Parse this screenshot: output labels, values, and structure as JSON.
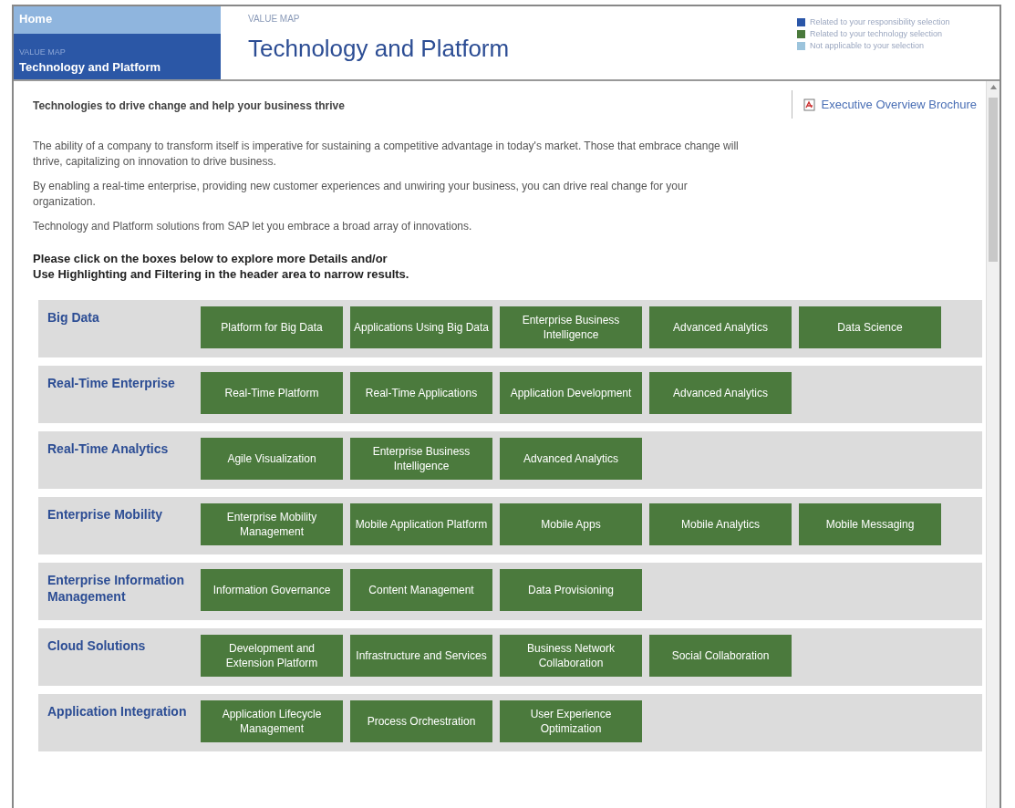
{
  "nav": {
    "home": "Home",
    "section_label": "VALUE MAP",
    "current": "Technology and Platform"
  },
  "header": {
    "eyebrow": "VALUE MAP",
    "title": "Technology and Platform"
  },
  "legend": [
    {
      "label": "Related to your responsibility selection",
      "color": "#2a56a8"
    },
    {
      "label": "Related to your technology selection",
      "color": "#4a7a3c"
    },
    {
      "label": "Not applicable to your selection",
      "color": "#9cc4dc"
    }
  ],
  "brochure_link": "Executive Overview Brochure",
  "heading": "Technologies to drive change and help your business thrive",
  "paragraphs": [
    "The ability of a company to transform itself is imperative for sustaining a competitive advantage in today's market. Those that embrace change will thrive, capitalizing on innovation to drive business.",
    "By enabling a real-time enterprise, providing new customer experiences and unwiring your business, you can drive real change for your organization.",
    "Technology and Platform solutions from SAP let you embrace a broad array of innovations."
  ],
  "instruction_lines": [
    "Please click on the boxes below to explore more Details and/or",
    "Use Highlighting and Filtering in the header area to narrow results."
  ],
  "categories": [
    {
      "name": "Big Data",
      "items": [
        "Platform for Big Data",
        "Applications Using Big Data",
        "Enterprise Business Intelligence",
        "Advanced Analytics",
        "Data Science"
      ]
    },
    {
      "name": "Real-Time Enterprise",
      "items": [
        "Real-Time Platform",
        "Real-Time Applications",
        "Application Development",
        "Advanced Analytics"
      ]
    },
    {
      "name": "Real-Time Analytics",
      "items": [
        "Agile Visualization",
        "Enterprise Business Intelligence",
        "Advanced Analytics"
      ]
    },
    {
      "name": "Enterprise Mobility",
      "items": [
        "Enterprise Mobility Management",
        "Mobile Application Platform",
        "Mobile Apps",
        "Mobile Analytics",
        "Mobile Messaging"
      ]
    },
    {
      "name": "Enterprise Information Management",
      "items": [
        "Information Governance",
        "Content Management",
        "Data Provisioning"
      ]
    },
    {
      "name": "Cloud Solutions",
      "items": [
        "Development and Extension Platform",
        "Infrastructure and Services",
        "Business Network Collaboration",
        "Social Collaboration"
      ]
    },
    {
      "name": "Application Integration",
      "items": [
        "Application Lifecycle Management",
        "Process Orchestration",
        "User Experience Optimization"
      ]
    }
  ]
}
